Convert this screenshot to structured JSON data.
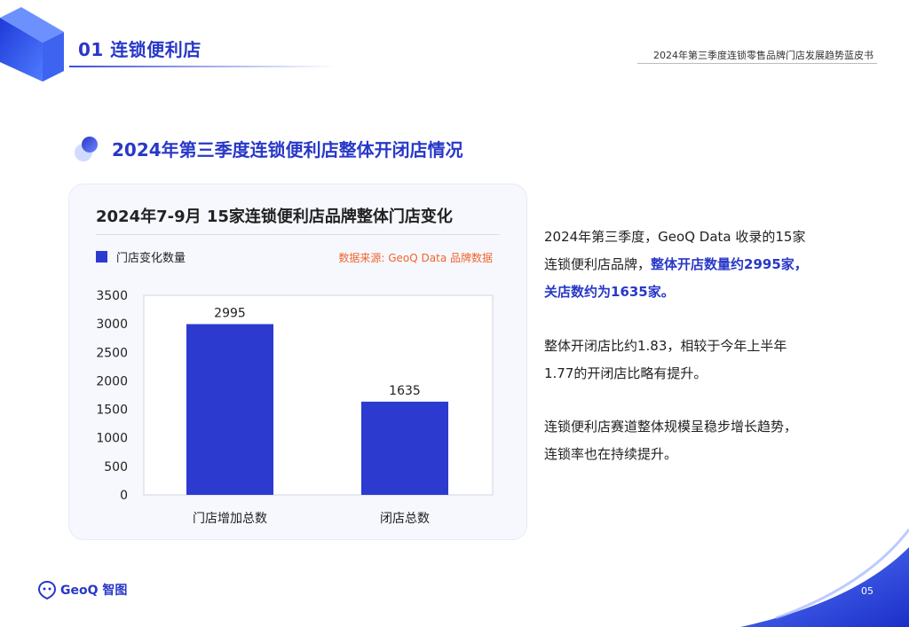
{
  "header": {
    "section_title": "01 连锁便利店",
    "report_title": "2024年第三季度连锁零售品牌门店发展趋势蓝皮书"
  },
  "subheading": "2024年第三季度连锁便利店整体开闭店情况",
  "card": {
    "title": "2024年7-9月 15家连锁便利店品牌整体门店变化",
    "legend_label": "门店变化数量",
    "source_note": "数据来源: GeoQ Data 品牌数据"
  },
  "chart_data": {
    "type": "bar",
    "title": "2024年7-9月 15家连锁便利店品牌整体门店变化",
    "xlabel": "",
    "ylabel": "",
    "categories": [
      "门店增加总数",
      "闭店总数"
    ],
    "series": [
      {
        "name": "门店变化数量",
        "values": [
          2995,
          1635
        ]
      }
    ],
    "data_labels": [
      "2995",
      "1635"
    ],
    "ylim": [
      0,
      3500
    ],
    "yticks": [
      0,
      500,
      1000,
      1500,
      2000,
      2500,
      3000,
      3500
    ],
    "grid": false,
    "legend_position": "top-left",
    "bar_color": "#2c3ad0"
  },
  "text": {
    "p1_line1": "2024年第三季度，GeoQ Data 收录的15家",
    "p1_line2_normal": "连锁便利店品牌，",
    "p1_line2_bold": "整体开店数量约2995家，",
    "p1_line3_bold": "关店数约为1635家。",
    "p2_line1": "整体开闭店比约1.83，相较于今年上半年",
    "p2_line2": "1.77的开闭店比略有提升。",
    "p3_line1": "连锁便利店赛道整体规模呈稳步增长趋势，",
    "p3_line2": "连锁率也在持续提升。"
  },
  "footer": {
    "logo_text": "GeoQ 智图",
    "page_number": "05"
  },
  "colors": {
    "accent": "#2838c8",
    "bar": "#2c3ad0",
    "source": "#f0652d"
  }
}
